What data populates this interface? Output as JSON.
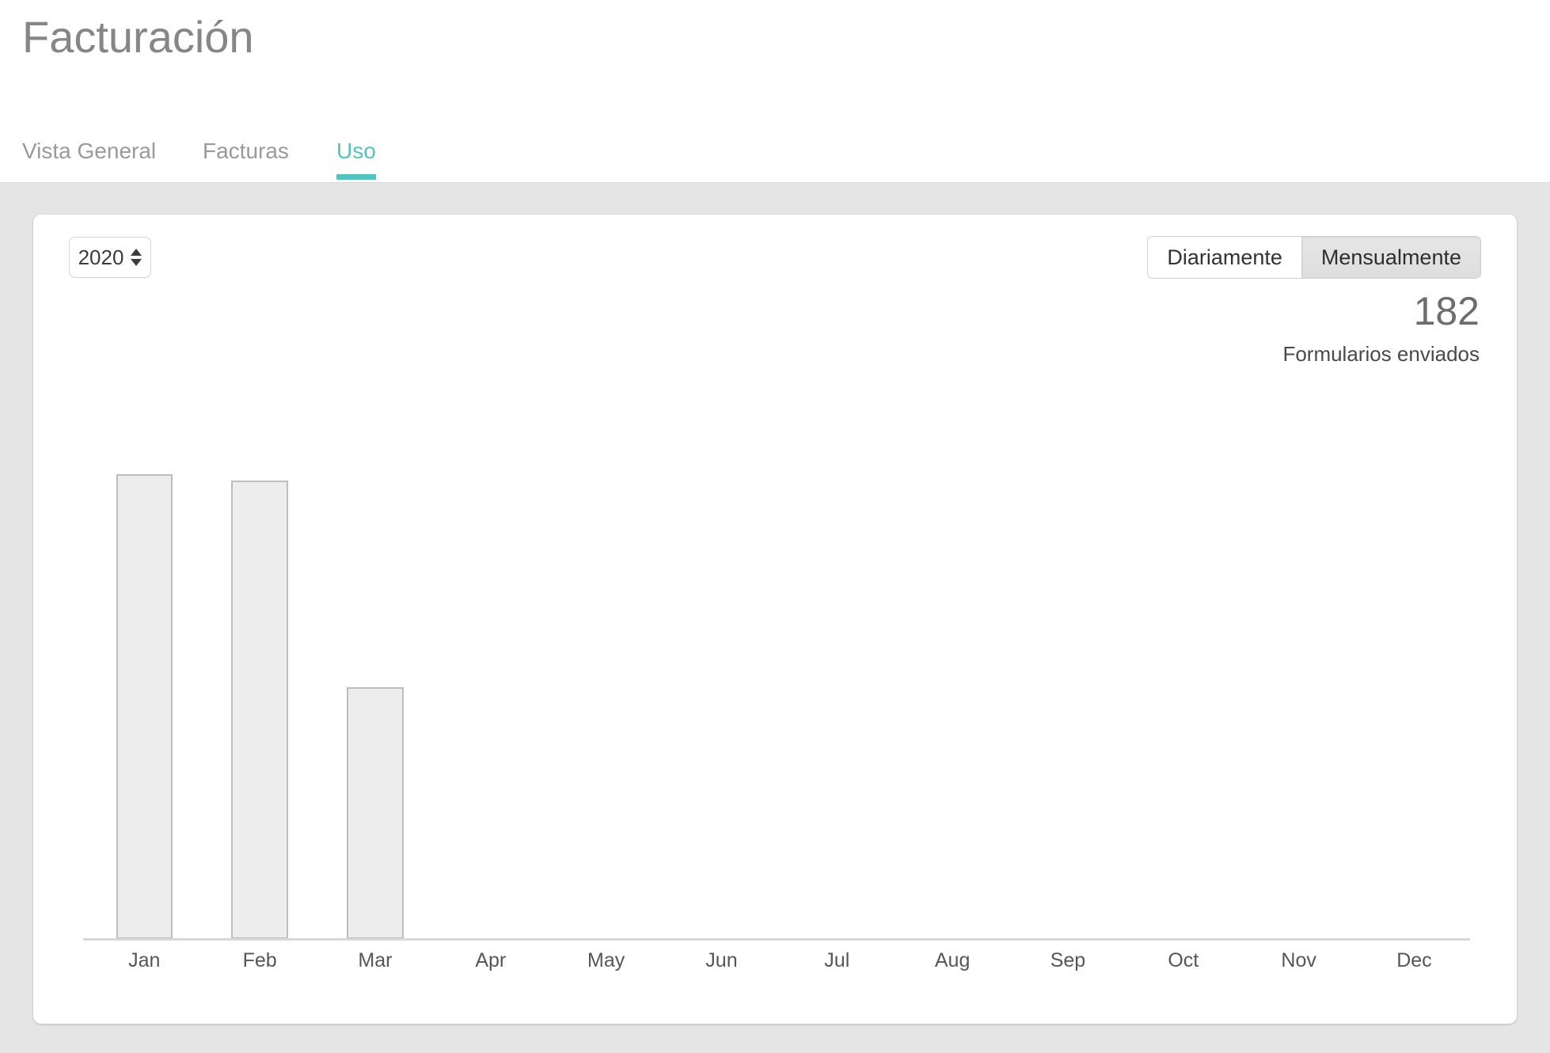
{
  "header": {
    "title": "Facturación"
  },
  "tabs": [
    {
      "label": "Vista General",
      "active": false
    },
    {
      "label": "Facturas",
      "active": false
    },
    {
      "label": "Uso",
      "active": true
    }
  ],
  "controls": {
    "year_select": {
      "value": "2020",
      "icon": "stepper-updown-icon"
    },
    "granularity": {
      "options": [
        {
          "label": "Diariamente",
          "active": false
        },
        {
          "label": "Mensualmente",
          "active": true
        }
      ]
    }
  },
  "stat": {
    "value": "182",
    "label": "Formularios enviados"
  },
  "colors": {
    "accent_teal": "#54c2bf",
    "page_background": "#e5e5e5",
    "card_background": "#ffffff",
    "bar_fill": "#ededed",
    "bar_border": "#bdbdbd",
    "axis_line": "#d3d8e3",
    "title_text": "#868686",
    "tab_inactive": "#9a9a9a"
  },
  "chart_data": {
    "type": "bar",
    "title": "",
    "xlabel": "",
    "ylabel": "",
    "categories": [
      "Jan",
      "Feb",
      "Mar",
      "Apr",
      "May",
      "Jun",
      "Jul",
      "Aug",
      "Sep",
      "Oct",
      "Nov",
      "Dec"
    ],
    "values": [
      72,
      71,
      39,
      0,
      0,
      0,
      0,
      0,
      0,
      0,
      0,
      0
    ],
    "ylim": [
      0,
      76
    ],
    "grid": false,
    "legend": false,
    "total": 182,
    "total_label": "Formularios enviados"
  }
}
